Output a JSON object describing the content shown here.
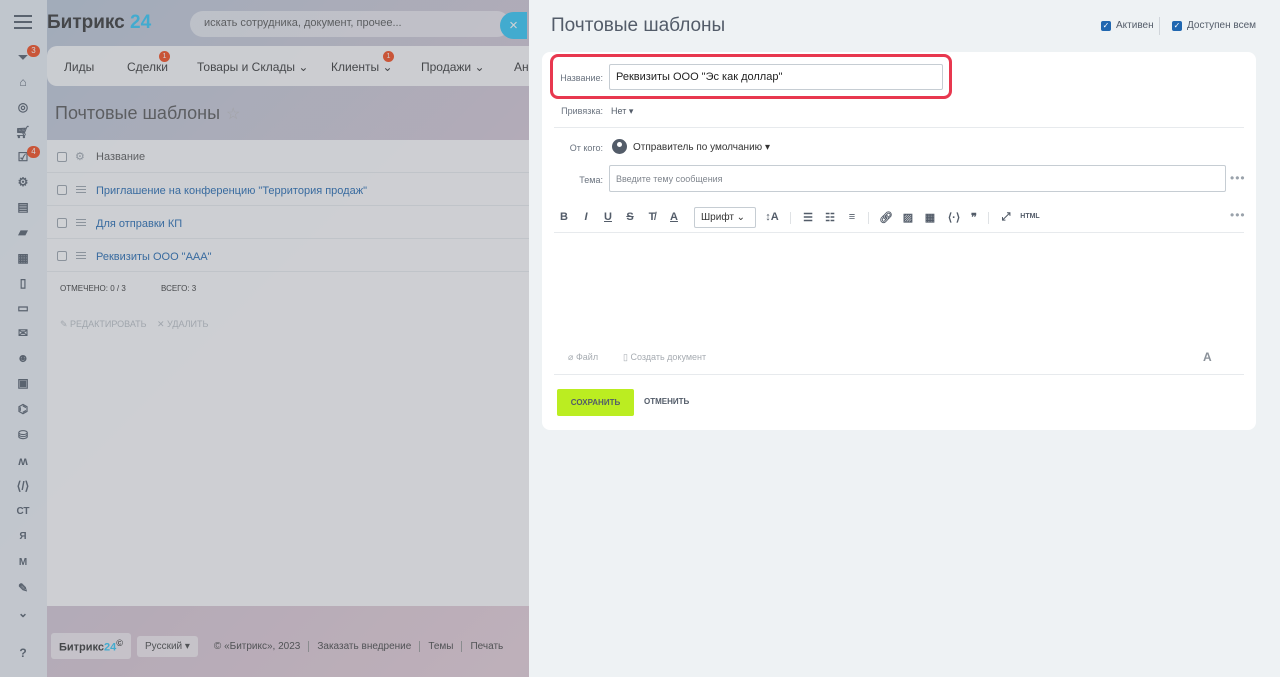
{
  "app": {
    "brand_main": "Битрикс",
    "brand_num": "24",
    "search_placeholder": "искать сотрудника, документ, прочее...",
    "close_glyph": "×",
    "rail_badges": {
      "filter": "3",
      "tasks": "4"
    },
    "rail_labels": {
      "st": "СТ",
      "ya": "Я",
      "m": "М"
    },
    "nav": [
      {
        "label": "Лиды"
      },
      {
        "label": "Сделки",
        "badge": "1"
      },
      {
        "label": "Товары и Склады ⌄"
      },
      {
        "label": "Клиенты ⌄",
        "badge": "1"
      },
      {
        "label": "Продажи ⌄"
      },
      {
        "label": "Ан"
      }
    ],
    "page_title": "Почтовые шаблоны",
    "grid": {
      "header": "Название",
      "rows": [
        "Приглашение на конференцию \"Территория продаж\"",
        "Для отправки КП",
        "Реквизиты ООО \"ААА\""
      ],
      "selected": "ОТМЕЧЕНО: 0 / 3",
      "total": "ВСЕГО: 3",
      "edit_action": "✎ РЕДАКТИРОВАТЬ",
      "delete_action": "✕ УДАЛИТЬ"
    },
    "footer": {
      "logo_main": "Битрикс",
      "logo_num": "24",
      "logo_mark": "©",
      "lang": "Русский ▾",
      "copyright": "© «Битрикс», 2023",
      "order": "Заказать внедрение",
      "themes": "Темы",
      "print": "Печать"
    }
  },
  "panel": {
    "title": "Почтовые шаблоны",
    "active_label": "Активен",
    "shared_label": "Доступен всем",
    "name_label": "Название:",
    "name_value": "Реквизиты ООО \"Эс как доллар\"",
    "binding_label": "Привязка:",
    "binding_value": "Нет ▾",
    "from_label": "От кого:",
    "from_value": "Отправитель по умолчанию ▾",
    "subject_label": "Тема:",
    "subject_placeholder": "Введите тему сообщения",
    "font_select": "Шрифт ⌄",
    "file_link": "Файл",
    "create_doc_link": "Создать документ",
    "save": "СОХРАНИТЬ",
    "cancel": "ОТМЕНИТЬ"
  }
}
